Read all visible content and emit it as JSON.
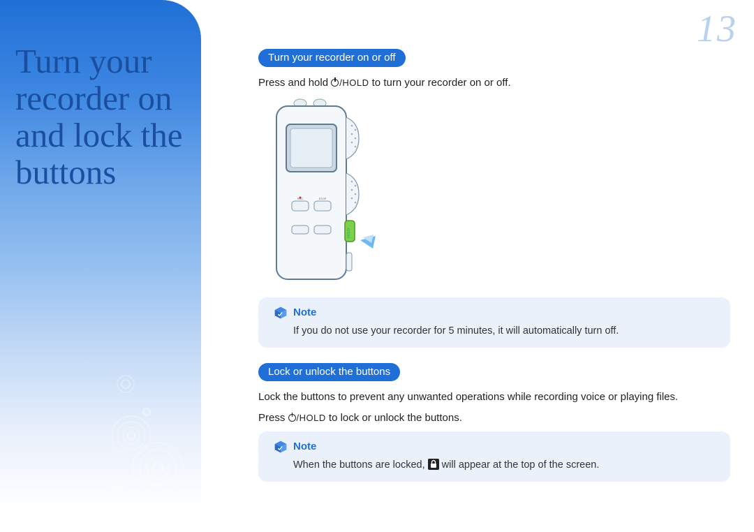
{
  "page_number": "13",
  "sidebar": {
    "title": "Turn your recorder on and lock the buttons"
  },
  "section_on_off": {
    "heading": "Turn your recorder on or off",
    "body_before": "Press and hold ",
    "body_button": "/HOLD",
    "body_after": " to turn your recorder on or off."
  },
  "note1": {
    "label": "Note",
    "text": "If you do not use your recorder for 5 minutes, it will automatically turn off."
  },
  "section_lock": {
    "heading": "Lock or unlock the buttons",
    "body_line1": "Lock the buttons to prevent any unwanted operations while recording voice or playing files.",
    "body_line2_before": "Press ",
    "body_line2_button": "/HOLD",
    "body_line2_after": " to lock or unlock the buttons."
  },
  "note2": {
    "label": "Note",
    "text_before": "When the buttons are locked, ",
    "text_after": " will appear at the top of the screen."
  }
}
